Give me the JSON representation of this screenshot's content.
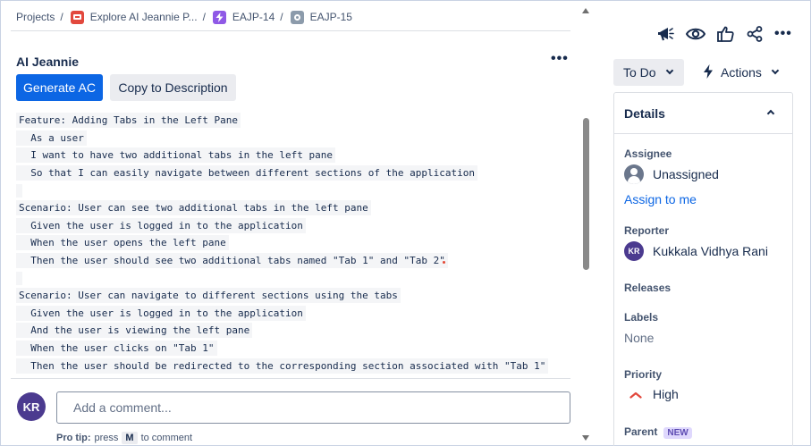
{
  "breadcrumb": {
    "items": [
      {
        "label": "Projects",
        "icon": null
      },
      {
        "label": "Explore AI Jeannie P...",
        "icon": "project-icon"
      },
      {
        "label": "EAJP-14",
        "icon": "epic-lightning-icon"
      },
      {
        "label": "EAJP-15",
        "icon": "subtask-icon"
      }
    ],
    "separator": "/"
  },
  "panel": {
    "title": "AI Jeannie",
    "more": "•••",
    "generate_label": "Generate AC",
    "copy_label": "Copy to Description",
    "lines": [
      "Feature: Adding Tabs in the Left Pane",
      "  As a user",
      "  I want to have two additional tabs in the left pane",
      "  So that I can easily navigate between different sections of the application",
      "",
      "Scenario: User can see two additional tabs in the left pane",
      "  Given the user is logged in to the application",
      "  When the user opens the left pane",
      "  Then the user should see two additional tabs named \"Tab 1\" and \"Tab 2\"",
      "",
      "Scenario: User can navigate to different sections using the tabs",
      "  Given the user is logged in to the application",
      "  And the user is viewing the left pane",
      "  When the user clicks on \"Tab 1\"",
      "  Then the user should be redirected to the corresponding section associated with \"Tab 1\""
    ]
  },
  "comment": {
    "avatar_initials": "KR",
    "placeholder": "Add a comment...",
    "pro_tip_label": "Pro tip:",
    "pro_tip_pre": "press",
    "pro_tip_key": "M",
    "pro_tip_post": "to comment"
  },
  "toolbar": {
    "icons": [
      "megaphone-icon",
      "eye-icon",
      "thumbs-up-icon",
      "share-icon"
    ],
    "more": "•••"
  },
  "status": {
    "label": "To Do"
  },
  "actions": {
    "label": "Actions"
  },
  "details": {
    "title": "Details",
    "assignee_label": "Assignee",
    "assignee_value": "Unassigned",
    "assign_link": "Assign to me",
    "reporter_label": "Reporter",
    "reporter_initials": "KR",
    "reporter_name": "Kukkala Vidhya Rani",
    "releases_label": "Releases",
    "labels_label": "Labels",
    "labels_value": "None",
    "priority_label": "Priority",
    "priority_value": "High",
    "parent_label": "Parent",
    "parent_badge": "NEW"
  },
  "colors": {
    "primary": "#0c66e4",
    "avatar": "#4b3a8f",
    "priority_high": "#e2483d",
    "new_badge_bg": "#dfd8fd"
  }
}
